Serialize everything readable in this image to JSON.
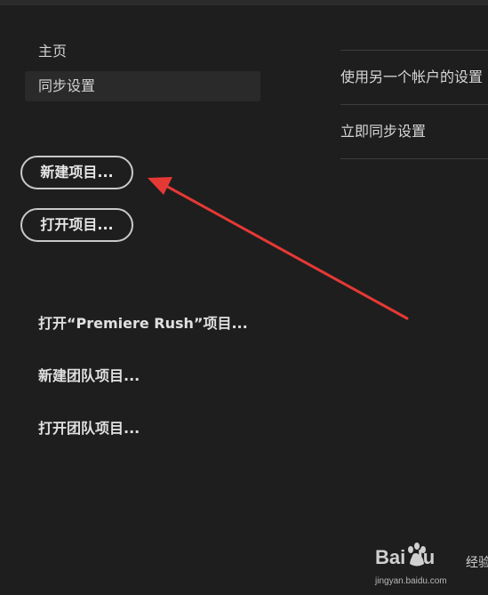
{
  "nav": {
    "home_label": "主页",
    "sync_label": "同步设置"
  },
  "actions": {
    "new_project": "新建项目...",
    "open_project": "打开项目..."
  },
  "links": {
    "open_rush": "打开“Premiere Rush”项目...",
    "new_team": "新建团队项目...",
    "open_team": "打开团队项目..."
  },
  "right_panel": {
    "items": [
      "使用另一个帐户的设置",
      "立即同步设置"
    ]
  },
  "watermark": {
    "brand": "Bai  du",
    "sub": "经验",
    "url": "jingyan.baidu.com"
  },
  "colors": {
    "background": "#1e1e1e",
    "annotation_arrow": "#e53935"
  }
}
